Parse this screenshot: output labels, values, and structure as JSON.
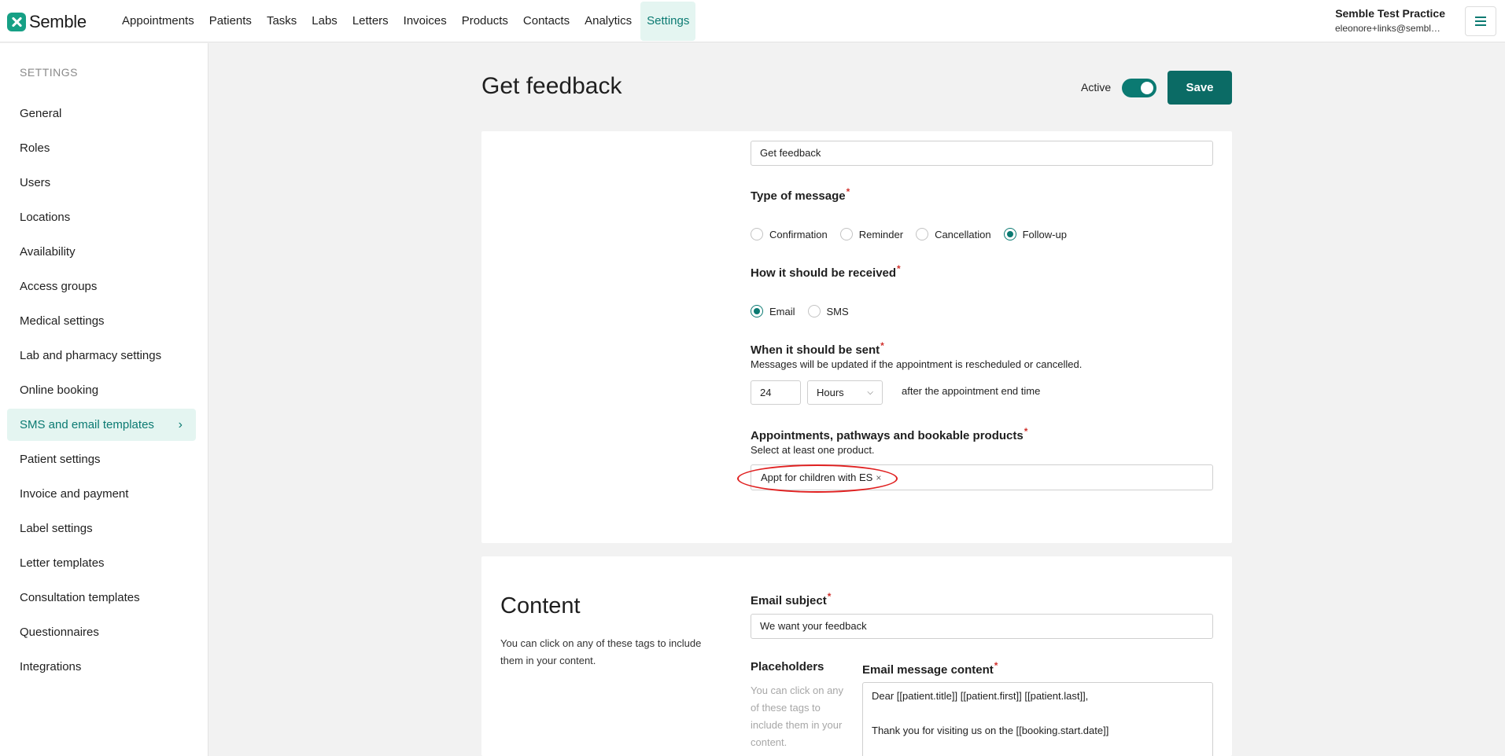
{
  "brand": {
    "name": "Semble"
  },
  "nav": [
    "Appointments",
    "Patients",
    "Tasks",
    "Labs",
    "Letters",
    "Invoices",
    "Products",
    "Contacts",
    "Analytics",
    "Settings"
  ],
  "account": {
    "practice": "Semble Test Practice",
    "email": "eleonore+links@semble.i..."
  },
  "sidebar": {
    "heading": "SETTINGS",
    "items": [
      {
        "label": "General"
      },
      {
        "label": "Roles"
      },
      {
        "label": "Users"
      },
      {
        "label": "Locations"
      },
      {
        "label": "Availability"
      },
      {
        "label": "Access groups"
      },
      {
        "label": "Medical settings"
      },
      {
        "label": "Lab and pharmacy settings"
      },
      {
        "label": "Online booking"
      },
      {
        "label": "SMS and email templates",
        "chevron": "›"
      },
      {
        "label": "Patient settings"
      },
      {
        "label": "Invoice and payment"
      },
      {
        "label": "Label settings"
      },
      {
        "label": "Letter templates"
      },
      {
        "label": "Consultation templates"
      },
      {
        "label": "Questionnaires"
      },
      {
        "label": "Integrations"
      }
    ]
  },
  "header": {
    "title": "Get feedback",
    "active_label": "Active",
    "active": true,
    "save_label": "Save"
  },
  "form": {
    "name_value": "Get feedback",
    "type_label": "Type of message",
    "type_options": [
      "Confirmation",
      "Reminder",
      "Cancellation",
      "Follow-up"
    ],
    "type_selected": "Follow-up",
    "received_label": "How it should be received",
    "received_options": [
      "Email",
      "SMS"
    ],
    "received_selected": "Email",
    "sent_label": "When it should be sent",
    "sent_hint": "Messages will be updated if the appointment is rescheduled or cancelled.",
    "sent_amount": "24",
    "sent_unit": "Hours",
    "sent_suffix": "after the appointment end time",
    "products_label": "Appointments, pathways and bookable products",
    "products_hint": "Select at least one product.",
    "products_tag": "Appt for children with ES",
    "required_mark": "*"
  },
  "content": {
    "title": "Content",
    "description": "You can click on any of these tags to include them in your content.",
    "subject_label": "Email subject",
    "subject_value": "We want your feedback",
    "placeholders_label": "Placeholders",
    "placeholders_desc": "You can click on any of these tags to include them in your content.",
    "message_label": "Email message content",
    "message_line1": "Dear [[patient.title]] [[patient.first]] [[patient.last]],",
    "message_line2": "Thank you for visiting us on the [[booking.start.date]]"
  },
  "colors": {
    "accent": "#0b7a72",
    "accent_light": "#e4f5f1",
    "required": "#d0312d",
    "highlight": "#e02020"
  }
}
